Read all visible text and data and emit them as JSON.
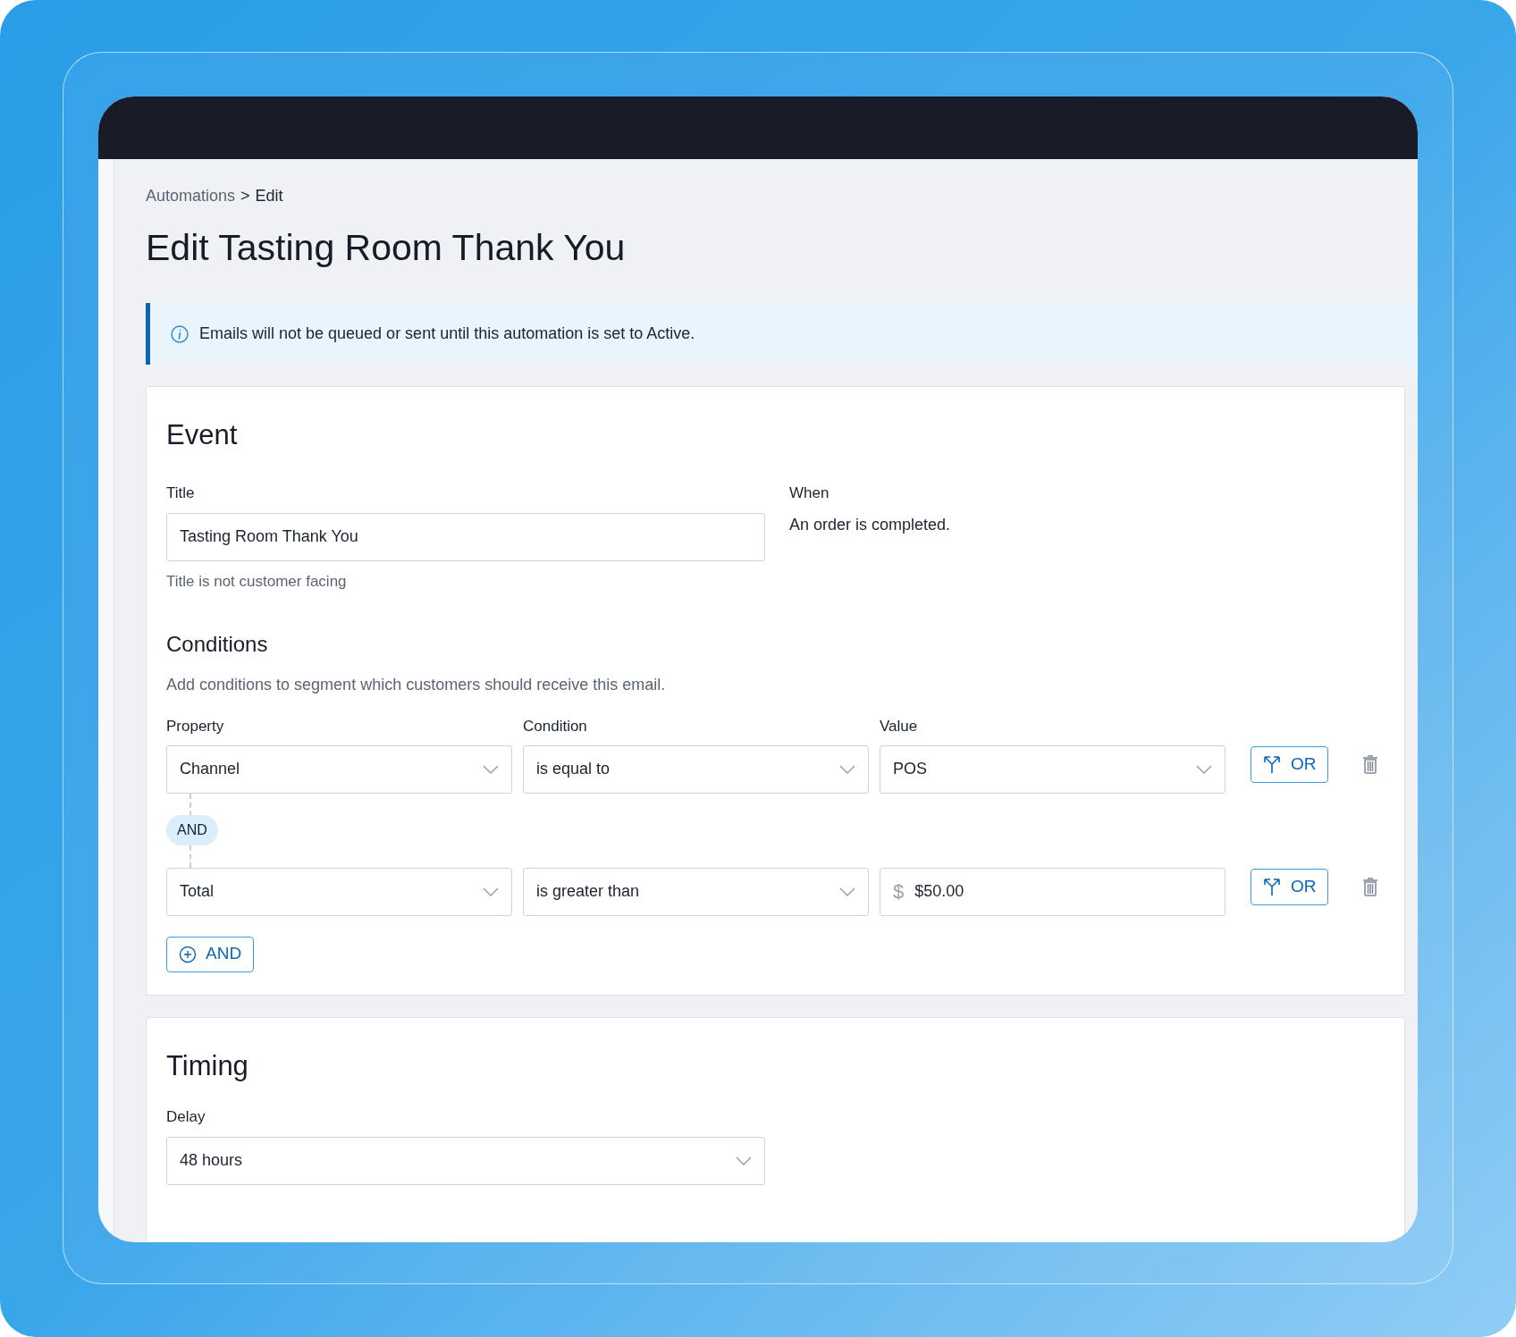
{
  "breadcrumb": {
    "separator": ">",
    "items": [
      {
        "label": "Automations",
        "current": false
      },
      {
        "label": "Edit",
        "current": true
      }
    ]
  },
  "page_title": "Edit Tasting Room Thank You",
  "info_banner": "Emails will not be queued or sent until this automation is set to Active.",
  "event": {
    "heading": "Event",
    "title_field": {
      "label": "Title",
      "value": "Tasting Room Thank You",
      "help": "Title is not customer facing"
    },
    "when": {
      "label": "When",
      "text": "An order is completed."
    }
  },
  "conditions": {
    "heading": "Conditions",
    "description": "Add conditions to segment which customers should receive this email.",
    "columns": [
      "Property",
      "Condition",
      "Value"
    ],
    "rows": [
      {
        "property": "Channel",
        "condition": "is equal to",
        "value": {
          "kind": "select",
          "text": "POS"
        },
        "or_button": "OR"
      },
      {
        "connector": "AND",
        "property": "Total",
        "condition": "is greater than",
        "value": {
          "kind": "currency",
          "prefix": "$",
          "text": "$50.00"
        },
        "or_button": "OR"
      }
    ],
    "add_button": "AND"
  },
  "timing": {
    "heading": "Timing",
    "delay": {
      "label": "Delay",
      "value": "48 hours"
    }
  }
}
